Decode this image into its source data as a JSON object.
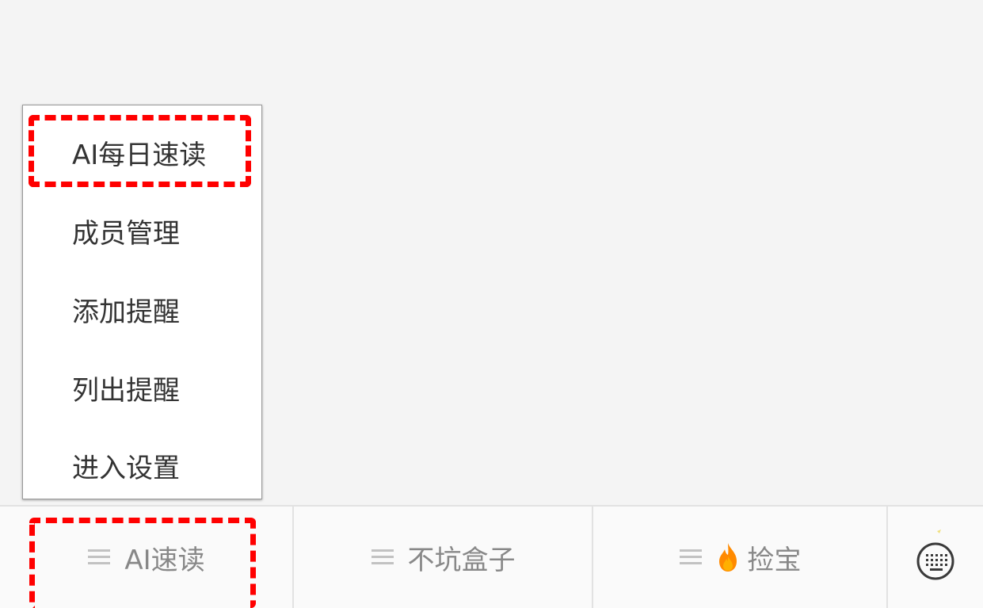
{
  "popup_menu": {
    "items": [
      {
        "label": "AI每日速读"
      },
      {
        "label": "成员管理"
      },
      {
        "label": "添加提醒"
      },
      {
        "label": "列出提醒"
      },
      {
        "label": "进入设置"
      }
    ]
  },
  "bottom_bar": {
    "tabs": [
      {
        "label": "AI速读",
        "icon": "menu-icon"
      },
      {
        "label": "不坑盒子",
        "icon": "menu-icon"
      },
      {
        "label": "捡宝",
        "icon": "menu-icon",
        "extra_icon": "fire-icon"
      }
    ],
    "keyboard_icon": "keyboard-icon"
  },
  "colors": {
    "highlight": "#ff0000",
    "fire": "#ff8a00",
    "text_menu": "#333333",
    "text_tab": "#888888"
  }
}
